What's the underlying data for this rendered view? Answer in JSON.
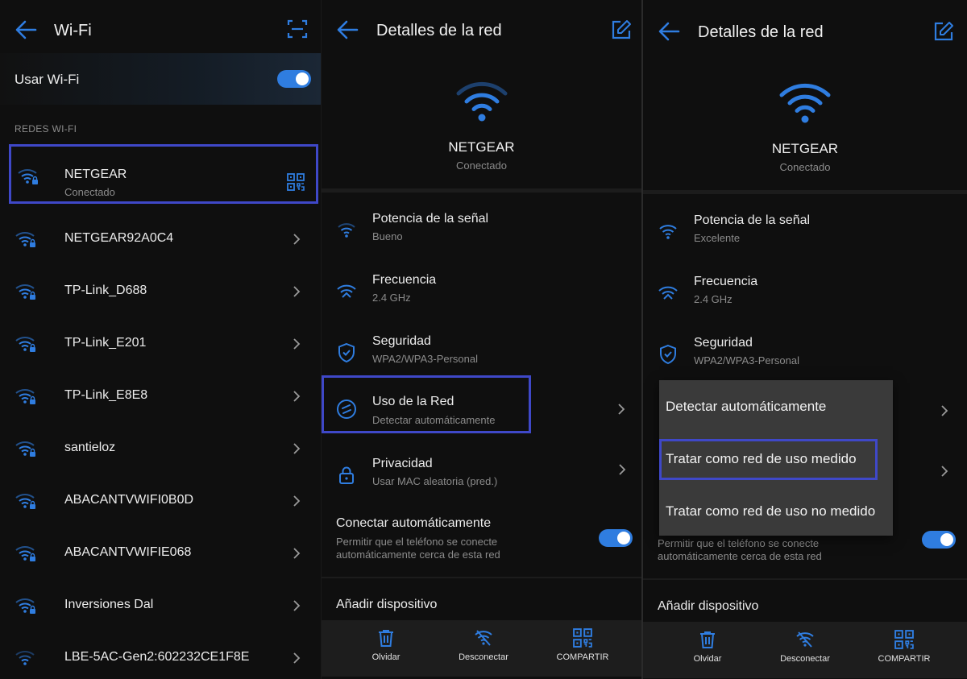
{
  "colors": {
    "accent": "#2f7de0",
    "highlight": "#3f48c8"
  },
  "panel1": {
    "title": "Wi-Fi",
    "toggle_label": "Usar Wi-Fi",
    "section_label": "REDES WI-FI",
    "connected": {
      "name": "NETGEAR",
      "status": "Conectado"
    },
    "networks": [
      "NETGEAR92A0C4",
      "TP-Link_D688",
      "TP-Link_E201",
      "TP-Link_E8E8",
      "santieloz",
      "ABACANTVWIFI0B0D",
      "ABACANTVWIFIE068",
      "Inversiones Dal",
      "LBE-5AC-Gen2:602232CE1F8E"
    ]
  },
  "panel2": {
    "title": "Detalles de la red",
    "network_name": "NETGEAR",
    "network_status": "Conectado",
    "signal": {
      "label": "Potencia de la señal",
      "value": "Bueno"
    },
    "frequency": {
      "label": "Frecuencia",
      "value": "2.4 GHz"
    },
    "security": {
      "label": "Seguridad",
      "value": "WPA2/WPA3-Personal"
    },
    "usage": {
      "label": "Uso de la Red",
      "value": "Detectar automáticamente"
    },
    "privacy": {
      "label": "Privacidad",
      "value": "Usar MAC aleatoria (pred.)"
    },
    "auto_connect": {
      "label": "Conectar automáticamente",
      "desc1": "Permitir que el teléfono se conecte",
      "desc2": "automáticamente cerca de esta red"
    },
    "add_device": "Añadir dispositivo",
    "bottom": {
      "forget": "Olvidar",
      "disconnect": "Desconectar",
      "share": "COMPARTIR"
    }
  },
  "panel3": {
    "title": "Detalles de la red",
    "network_name": "NETGEAR",
    "network_status": "Conectado",
    "signal": {
      "label": "Potencia de la señal",
      "value": "Excelente"
    },
    "frequency": {
      "label": "Frecuencia",
      "value": "2.4 GHz"
    },
    "security": {
      "label": "Seguridad",
      "value": "WPA2/WPA3-Personal"
    },
    "popup": {
      "opt1": "Detectar automáticamente",
      "opt2": "Tratar como red de uso medido",
      "opt3": "Tratar como red de uso no medido"
    },
    "auto_connect": {
      "desc1": "Permitir que el teléfono se conecte",
      "desc2": "automáticamente cerca de esta red"
    },
    "add_device": "Añadir dispositivo",
    "bottom": {
      "forget": "Olvidar",
      "disconnect": "Desconectar",
      "share": "COMPARTIR"
    }
  }
}
